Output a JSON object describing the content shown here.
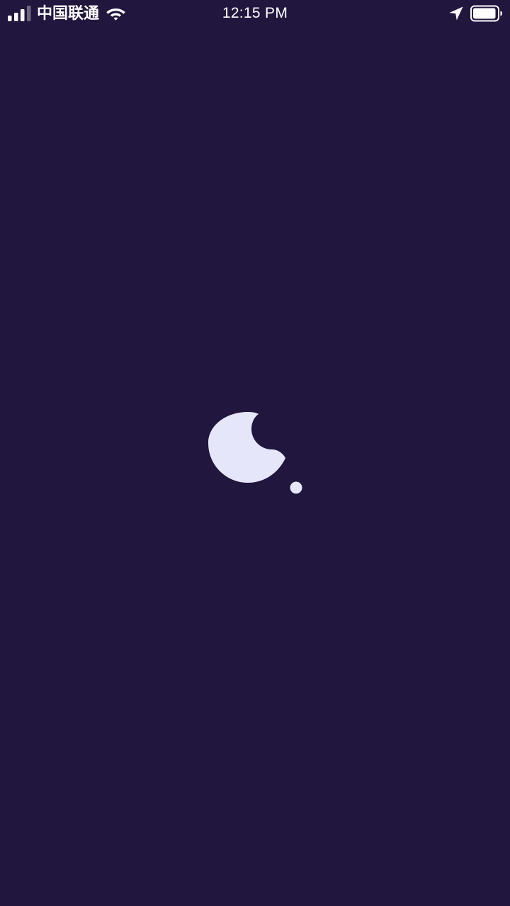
{
  "status_bar": {
    "carrier": "中国联通",
    "time": "12:15 PM",
    "signal_bars": 3,
    "signal_bars_total": 4,
    "battery_level": 0.9,
    "icons": [
      "signal-bars-icon",
      "wifi-icon",
      "location-arrow-icon",
      "battery-icon"
    ]
  },
  "splash": {
    "logo_icon": "crescent-moon-dot-icon"
  },
  "colors": {
    "background": "#21163d",
    "logo": "#e6e6fb",
    "status_text": "#ffffff"
  }
}
